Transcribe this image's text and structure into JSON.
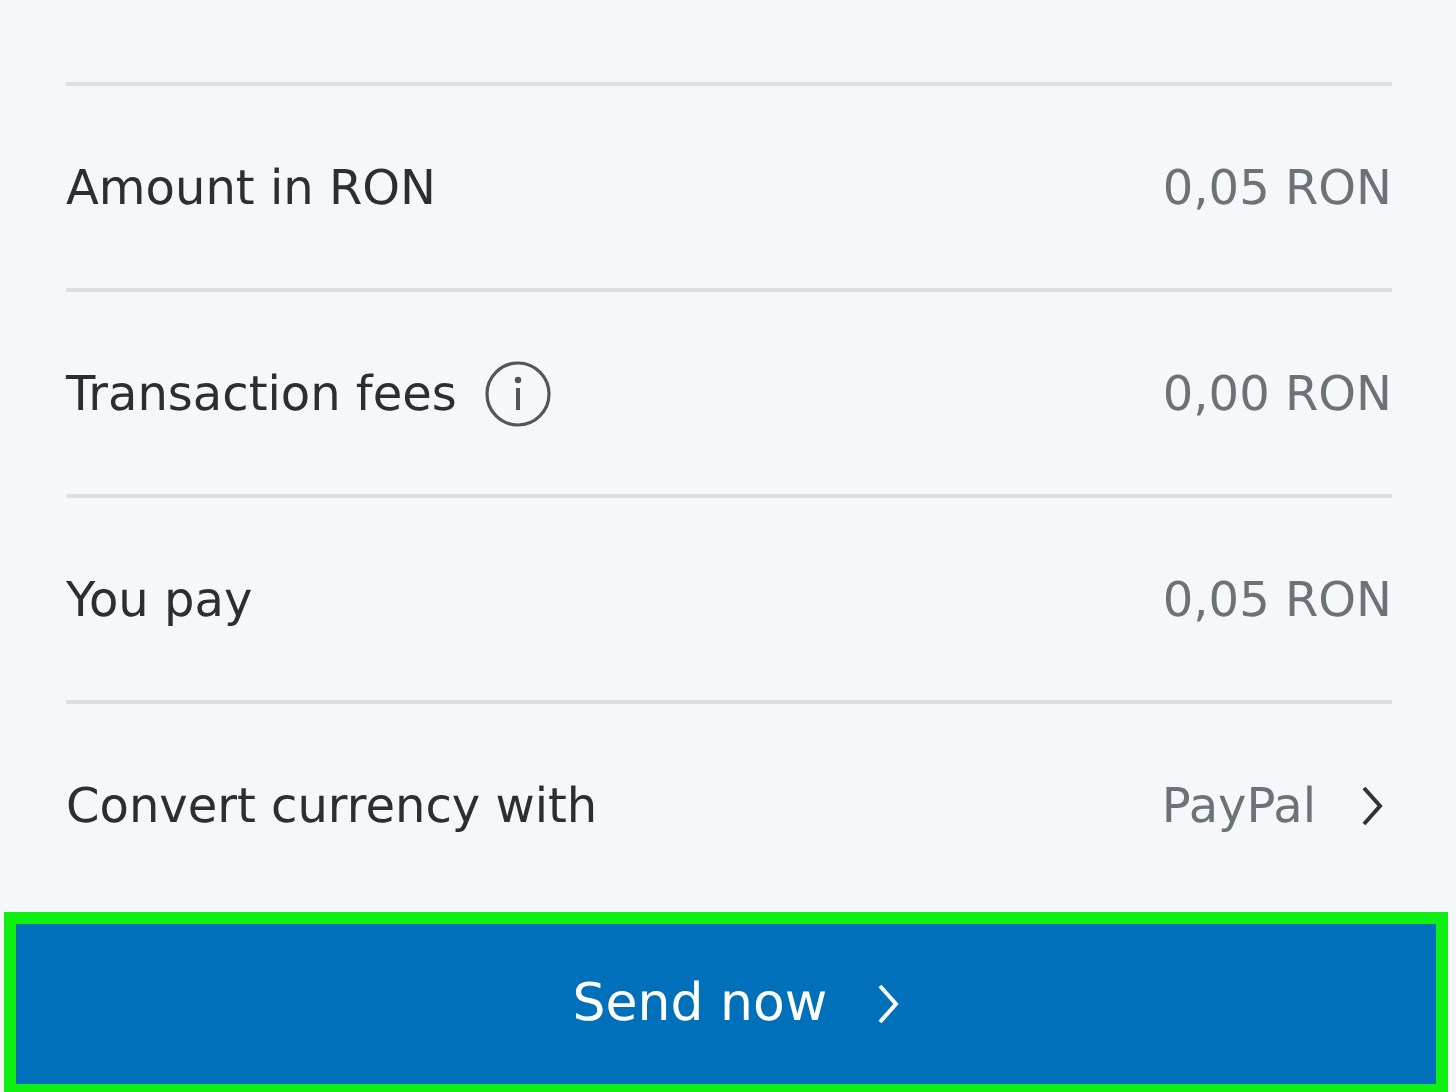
{
  "rows": [
    {
      "kind": "plain",
      "label": "Amount in RON",
      "value": "0,05 RON"
    },
    {
      "kind": "info",
      "label": "Transaction fees",
      "value": "0,00 RON"
    },
    {
      "kind": "plain",
      "label": "You pay",
      "value": "0,05 RON"
    },
    {
      "kind": "link",
      "label": "Convert currency with",
      "value": "PayPal"
    }
  ],
  "send_button": {
    "label": "Send now",
    "highlighted": true
  }
}
